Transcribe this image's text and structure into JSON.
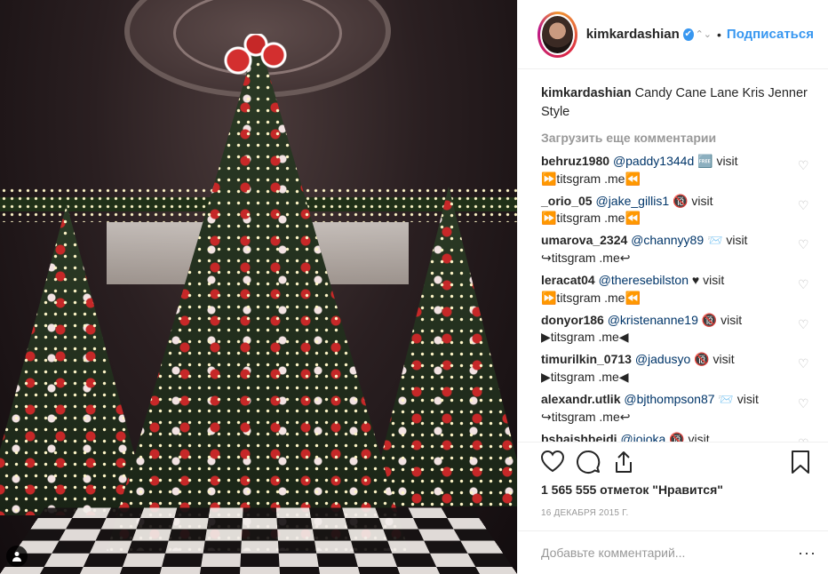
{
  "post": {
    "username": "kimkardashian",
    "follow_label": "Подписаться",
    "caption_text": "Candy Cane Lane Kris Jenner Style",
    "load_more_label": "Загрузить еще комментарии",
    "likes": "1 565 555 отметок \"Нравится\"",
    "date": "16 ДЕКАБРЯ 2015 Г.",
    "add_comment_placeholder": "Добавьте комментарий...",
    "options_icon": "ellipsis-icon",
    "options_glyph": "···"
  },
  "comments": [
    {
      "user": "behruz1980",
      "mention": "@paddy1344d",
      "text": " 🆓 visit ⏩titsgram .me⏪"
    },
    {
      "user": "_orio_05",
      "mention": "@jake_gillis1",
      "text": " 🔞 visit ⏩titsgram .me⏪"
    },
    {
      "user": "umarova_2324",
      "mention": "@channyy89",
      "text": " 📨 visit ↪titsgram .me↩"
    },
    {
      "user": "leracat04",
      "mention": "@theresebilston",
      "text": " ♥ visit ⏩titsgram .me⏪"
    },
    {
      "user": "donyor186",
      "mention": "@kristenanne19",
      "text": " 🔞 visit ▶titsgram .me◀"
    },
    {
      "user": "timurilkin_0713",
      "mention": "@jadusyo",
      "text": " 🔞 visit ▶titsgram .me◀"
    },
    {
      "user": "alexandr.utlik",
      "mention": "@bjthompson87",
      "text": " 📨 visit ↪titsgram .me↩"
    },
    {
      "user": "bshaishbeidi",
      "mention": "@jojoka",
      "text": " 🔞 visit"
    }
  ],
  "icons": {
    "like": "heart-icon",
    "comment": "comment-icon",
    "share": "share-icon",
    "save": "bookmark-icon",
    "verified": "verified-badge-icon",
    "user_tag": "user-tag-icon"
  },
  "colors": {
    "accent": "#3897f0",
    "mention": "#003569",
    "muted": "#999999"
  }
}
